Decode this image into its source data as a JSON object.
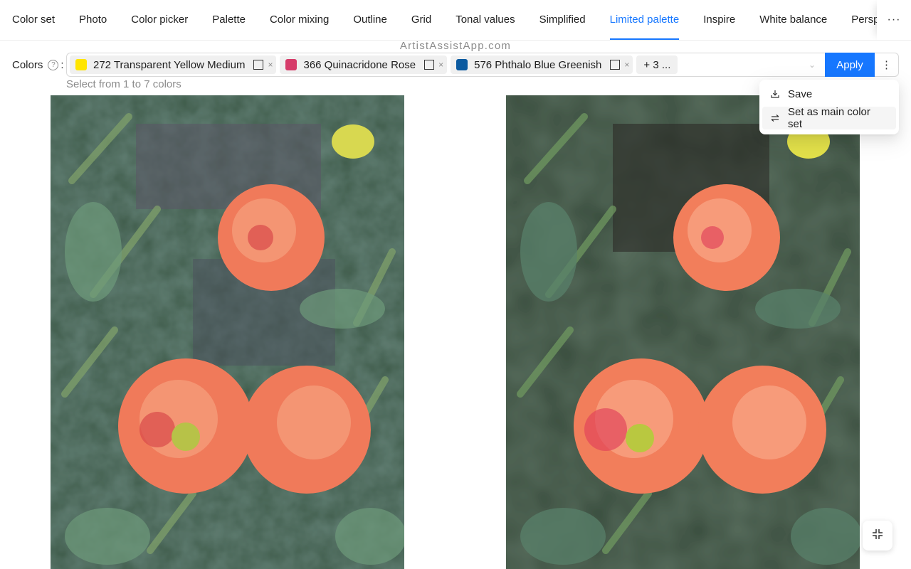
{
  "tabs": [
    {
      "label": "Color set"
    },
    {
      "label": "Photo"
    },
    {
      "label": "Color picker"
    },
    {
      "label": "Palette"
    },
    {
      "label": "Color mixing"
    },
    {
      "label": "Outline"
    },
    {
      "label": "Grid"
    },
    {
      "label": "Tonal values"
    },
    {
      "label": "Simplified"
    },
    {
      "label": "Limited palette"
    },
    {
      "label": "Inspire"
    },
    {
      "label": "White balance"
    },
    {
      "label": "Perspective"
    }
  ],
  "active_tab": "Limited palette",
  "tabs_more_label": "···",
  "watermark": "ArtistAssistApp.com",
  "colors": {
    "label": "Colors",
    "help_glyph": "?",
    "colon": ":",
    "hint": "Select from 1 to 7 colors",
    "tags": [
      {
        "label": "272 Transparent Yellow Medium",
        "color": "#FFE500"
      },
      {
        "label": "366 Quinacridone Rose",
        "color": "#D63C6A"
      },
      {
        "label": "576 Phthalo Blue Greenish",
        "color": "#0B5AA0"
      }
    ],
    "more_tags": "+ 3 ...",
    "tag_close": "×",
    "chevron": "⌄",
    "apply_label": "Apply",
    "kebab": "⋮"
  },
  "menu": {
    "items": [
      {
        "label": "Save",
        "icon": "download-icon",
        "glyph": "⤓"
      },
      {
        "label": "Set as main color set",
        "icon": "swap-icon",
        "glyph": "⇋"
      }
    ]
  },
  "images": {
    "left": "limited-palette-simplified-dahlias",
    "right": "original-photo-dahlias"
  },
  "fullscreen_icon": "fullscreen-exit-icon"
}
